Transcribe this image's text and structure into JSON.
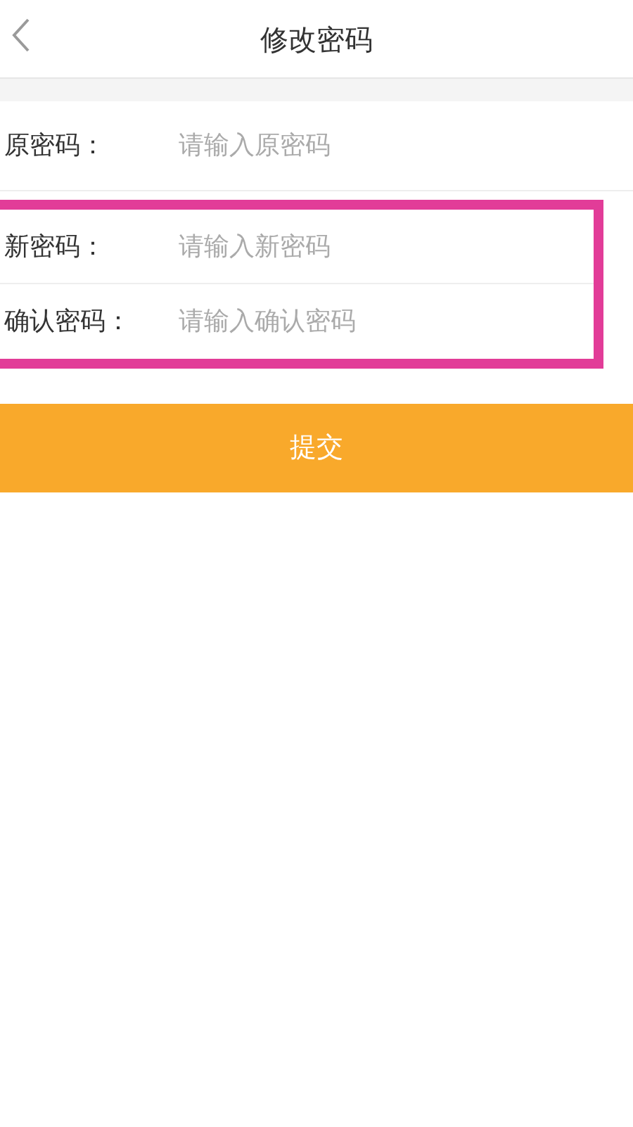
{
  "header": {
    "title": "修改密码"
  },
  "fields": [
    {
      "label": "原密码：",
      "placeholder": "请输入原密码",
      "highlighted": false
    },
    {
      "label": "新密码：",
      "placeholder": "请输入新密码",
      "highlighted": true
    },
    {
      "label": "确认密码：",
      "placeholder": "请输入确认密码",
      "highlighted": true
    }
  ],
  "submit_button": "提交"
}
